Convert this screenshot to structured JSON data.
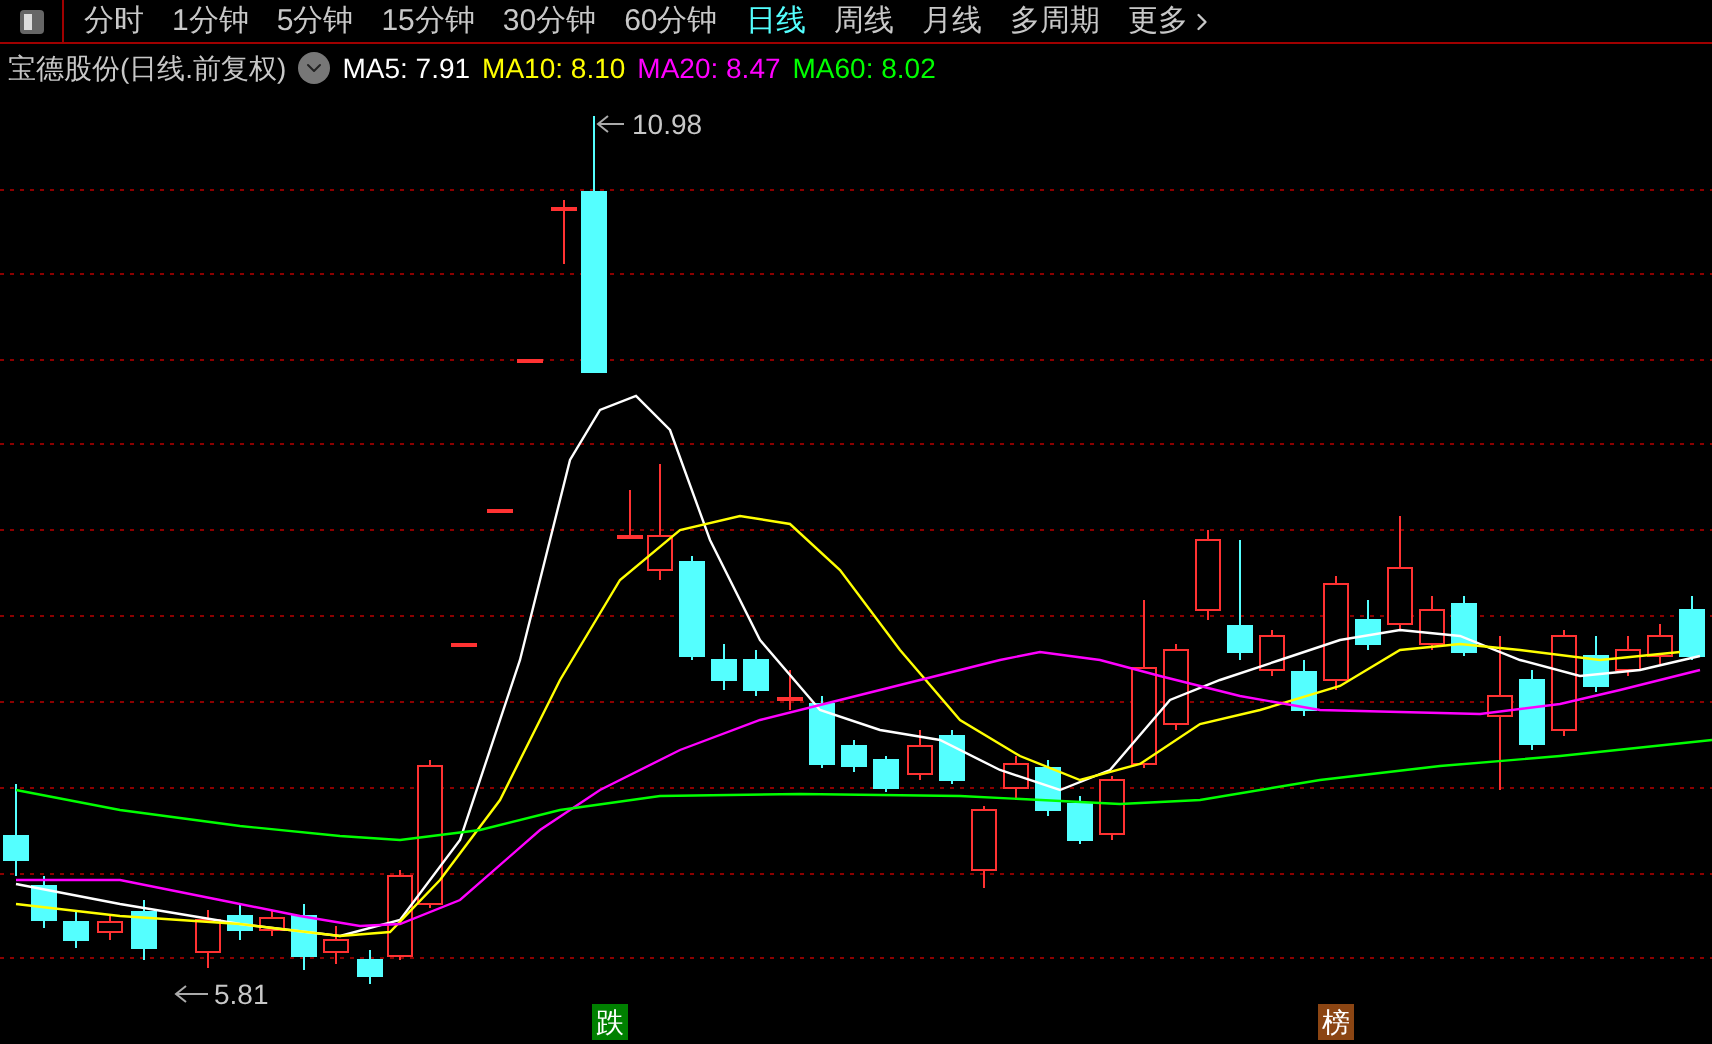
{
  "tabs": [
    {
      "label": "分时",
      "selected": false
    },
    {
      "label": "1分钟",
      "selected": false
    },
    {
      "label": "5分钟",
      "selected": false
    },
    {
      "label": "15分钟",
      "selected": false
    },
    {
      "label": "30分钟",
      "selected": false
    },
    {
      "label": "60分钟",
      "selected": false
    },
    {
      "label": "日线",
      "selected": true
    },
    {
      "label": "周线",
      "selected": false
    },
    {
      "label": "月线",
      "selected": false
    },
    {
      "label": "多周期",
      "selected": false
    },
    {
      "label": "更多",
      "selected": false
    }
  ],
  "chart": {
    "title": "宝德股份(日线.前复权)",
    "moving_averages": [
      {
        "label": "MA5:",
        "value": "7.91",
        "color": "#ffffff"
      },
      {
        "label": "MA10:",
        "value": "8.10",
        "color": "#ffff00"
      },
      {
        "label": "MA20:",
        "value": "8.47",
        "color": "#ff00ff"
      },
      {
        "label": "MA60:",
        "value": "8.02",
        "color": "#00ff00"
      }
    ],
    "high_marker": "10.98",
    "low_marker": "5.81",
    "tags": [
      {
        "text": "跌",
        "color": "#008000"
      },
      {
        "text": "榜",
        "color": "#8b4513"
      }
    ]
  }
}
